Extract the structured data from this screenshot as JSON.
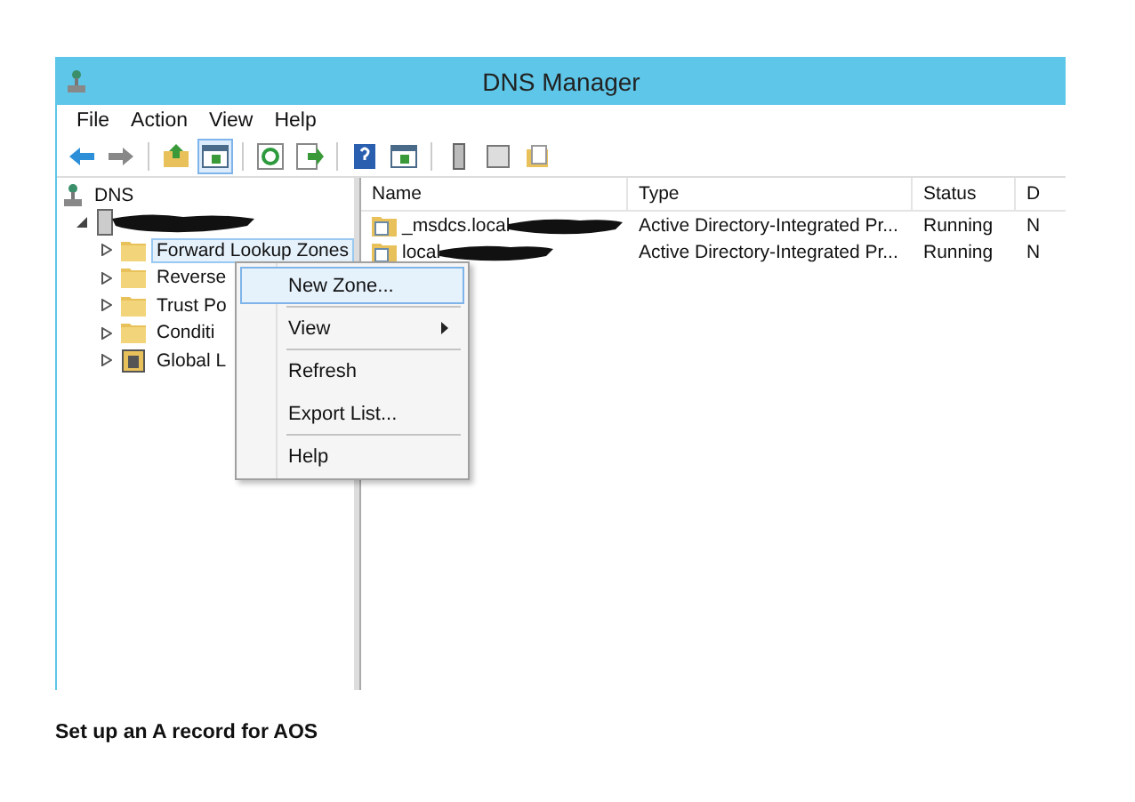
{
  "window": {
    "title": "DNS Manager"
  },
  "menu_bar": [
    "File",
    "Action",
    "View",
    "Help"
  ],
  "toolbar": [
    {
      "kind": "back"
    },
    {
      "kind": "forward"
    },
    {
      "kind": "sep"
    },
    {
      "kind": "up"
    },
    {
      "kind": "tree",
      "selected": true
    },
    {
      "kind": "sep"
    },
    {
      "kind": "refresh"
    },
    {
      "kind": "export"
    },
    {
      "kind": "sep"
    },
    {
      "kind": "help"
    },
    {
      "kind": "view"
    },
    {
      "kind": "sep"
    },
    {
      "kind": "server"
    },
    {
      "kind": "list"
    },
    {
      "kind": "folder"
    }
  ],
  "tree": [
    {
      "label": "DNS",
      "children": [
        {
          "redacted": true,
          "expanded": true,
          "children": [
            {
              "label": "Forward Lookup Zones",
              "kind": "folder",
              "selected": true
            },
            {
              "label": "Reverse",
              "kind": "folder",
              "selected": false
            },
            {
              "label": "Trust Po",
              "kind": "folder",
              "selected": false
            },
            {
              "label": "Conditi",
              "kind": "folder",
              "selected": false
            },
            {
              "label": "Global L",
              "kind": "global",
              "selected": false
            }
          ]
        }
      ]
    }
  ],
  "columns": [
    "Name",
    "Type",
    "Status",
    "D"
  ],
  "rows": [
    {
      "name": "_msdcs.local",
      "type": "Active Directory-Integrated Pr...",
      "status": "Running",
      "column_4": "N",
      "redacted": true
    },
    {
      "name": "local",
      "type": "Active Directory-Integrated Pr...",
      "status": "Running",
      "column_4": "N",
      "redacted": true
    }
  ],
  "context_menu": [
    {
      "label": "New Zone...",
      "selected": true,
      "submenu": false,
      "separator_after": true
    },
    {
      "label": "View",
      "selected": false,
      "submenu": true,
      "separator_after": true
    },
    {
      "label": "Refresh",
      "selected": false,
      "submenu": false,
      "separator_after": false
    },
    {
      "label": "Export List...",
      "selected": false,
      "submenu": false,
      "separator_after": true
    },
    {
      "label": "Help",
      "selected": false,
      "submenu": false,
      "separator_after": false
    }
  ],
  "caption": "Set up an A record for AOS"
}
